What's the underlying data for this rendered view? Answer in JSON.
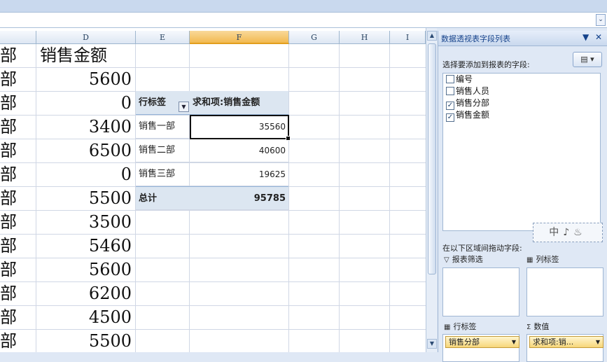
{
  "formula_bar": {
    "expand_icon": "chevron-down-icon"
  },
  "columns": [
    "D",
    "E",
    "F",
    "G",
    "H",
    "I"
  ],
  "selected_column": "F",
  "column_c_fragments": [
    "部",
    "部",
    "部",
    "部",
    "部",
    "部",
    "部",
    "部",
    "部",
    "部",
    "部",
    "部",
    "部"
  ],
  "column_d": {
    "header": "销售金额",
    "values": [
      "5600",
      "0",
      "3400",
      "6500",
      "0",
      "5500",
      "3500",
      "5460",
      "5600",
      "6200",
      "4500",
      "5500"
    ]
  },
  "pivot": {
    "row_label_header": "行标签",
    "value_header": "求和项:销售金额",
    "rows": [
      {
        "label": "销售一部",
        "value": "35560"
      },
      {
        "label": "销售二部",
        "value": "40600"
      },
      {
        "label": "销售三部",
        "value": "19625"
      }
    ],
    "total_label": "总计",
    "total_value": "95785"
  },
  "field_pane": {
    "title": "数据透视表字段列表",
    "choose_label": "选择要添加到报表的字段:",
    "fields": [
      {
        "name": "编号",
        "checked": false
      },
      {
        "name": "销售人员",
        "checked": false
      },
      {
        "name": "销售分部",
        "checked": true
      },
      {
        "name": "销售金额",
        "checked": true
      }
    ],
    "drag_hint": "在以下区域间拖动字段:",
    "zones": {
      "filter": "报表筛选",
      "columns": "列标签",
      "rows": "行标签",
      "values": "数值"
    },
    "row_item": "销售分部",
    "value_item": "求和项:销...",
    "ime_text": "中♪♨"
  }
}
